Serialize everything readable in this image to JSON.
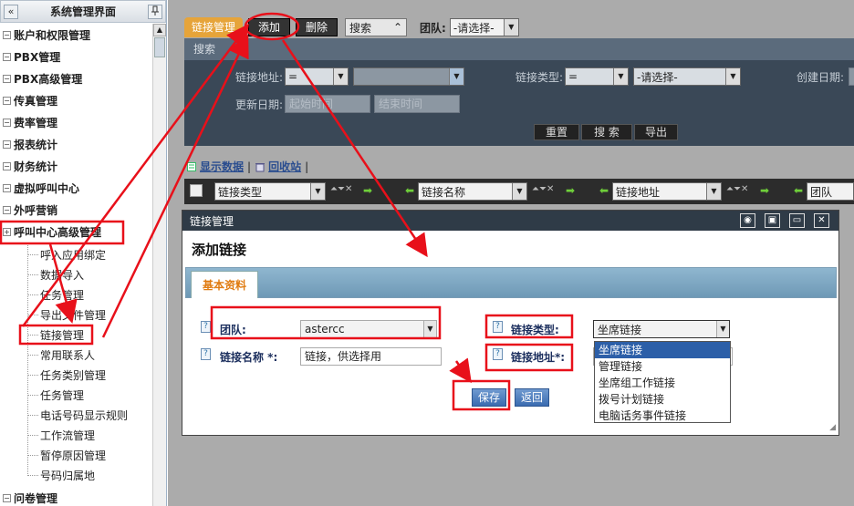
{
  "sidebar": {
    "collapse_icon": "«",
    "title": "系统管理界面",
    "pin_icon": "pin-icon",
    "categories": [
      {
        "label": "账户和权限管理",
        "toggle": "−"
      },
      {
        "label": "PBX管理",
        "toggle": "−"
      },
      {
        "label": "PBX高级管理",
        "toggle": "−"
      },
      {
        "label": "传真管理",
        "toggle": "−"
      },
      {
        "label": "费率管理",
        "toggle": "−"
      },
      {
        "label": "报表统计",
        "toggle": "−"
      },
      {
        "label": "财务统计",
        "toggle": "−"
      },
      {
        "label": "虚拟呼叫中心",
        "toggle": "−"
      },
      {
        "label": "外呼营销",
        "toggle": "−"
      },
      {
        "label": "呼叫中心高级管理",
        "toggle": "+"
      },
      {
        "label": "问卷管理",
        "toggle": "−"
      }
    ],
    "items": [
      "呼入应用绑定",
      "数据导入",
      "任务管理",
      "导出文件管理",
      "链接管理",
      "常用联系人",
      "任务类别管理",
      "任务管理",
      "电话号码显示规则",
      "工作流管理",
      "暂停原因管理",
      "号码归属地"
    ]
  },
  "toolbar": {
    "tab": "链接管理",
    "add": "添加",
    "delete": "删除",
    "search": "搜索",
    "search_arrow": "⌃",
    "team_label": "团队:",
    "team_value": "-请选择-"
  },
  "search_panel": {
    "title": "搜索",
    "link_address_label": "链接地址:",
    "link_address_op": "=",
    "link_type_label": "链接类型:",
    "link_type_op": "=",
    "link_type_value": "-请选择-",
    "created_label": "创建日期:",
    "updated_label": "更新日期:",
    "start_placeholder": "起始时间",
    "end_placeholder": "结束时间",
    "reset": "重置",
    "search": "搜 索",
    "export": "导出"
  },
  "links": {
    "show_data": "显示数据",
    "separator": "|",
    "recycle": "回收站",
    "trailing": "|"
  },
  "columns": [
    {
      "label": "链接类型",
      "controls": "⏶⏷✕"
    },
    {
      "label": "链接名称",
      "controls": "⏶⏷✕"
    },
    {
      "label": "链接地址",
      "controls": "⏶⏷✕"
    },
    {
      "label": "团队",
      "controls": ""
    }
  ],
  "dialog": {
    "title": "链接管理",
    "heading": "添加链接",
    "tab": "基本资料",
    "team_label": "团队:",
    "team_value": "astercc",
    "link_type_label": "链接类型:",
    "link_type_value": "坐席链接",
    "link_name_label": "链接名称 *:",
    "link_name_value": "链接，供选择用",
    "link_address_label": "链接地址*:",
    "save": "保存",
    "back": "返回",
    "link_type_options": [
      "坐席链接",
      "管理链接",
      "坐席组工作链接",
      "拨号计划链接",
      "电脑话务事件链接"
    ],
    "help_icon": "?"
  },
  "colors": {
    "annotation_red": "#e8101a",
    "tab_orange": "#e6a43a",
    "dialog_titlebar": "#2f3b47",
    "highlight_blue": "#2c5fa8"
  }
}
